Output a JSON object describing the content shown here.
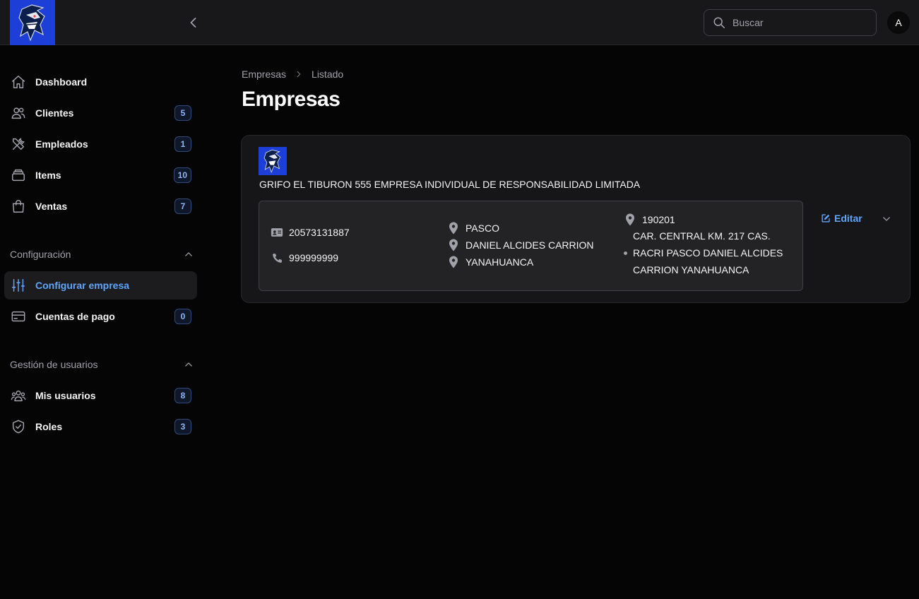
{
  "header": {
    "search": {
      "placeholder": "Buscar"
    },
    "user_initial": "A"
  },
  "sidebar": {
    "items": [
      {
        "label": "Dashboard",
        "icon": "home-icon"
      },
      {
        "label": "Clientes",
        "icon": "users-icon",
        "badge": "5"
      },
      {
        "label": "Empleados",
        "icon": "tools-icon",
        "badge": "1"
      },
      {
        "label": "Items",
        "icon": "stack-icon",
        "badge": "10"
      },
      {
        "label": "Ventas",
        "icon": "shopping-bag-icon",
        "badge": "7"
      }
    ],
    "groups": [
      {
        "title": "Configuración",
        "items": [
          {
            "label": "Configurar empresa",
            "icon": "sliders-icon",
            "active": true
          },
          {
            "label": "Cuentas de pago",
            "icon": "credit-card-icon",
            "badge": "0"
          }
        ]
      },
      {
        "title": "Gestión de usuarios",
        "items": [
          {
            "label": "Mis usuarios",
            "icon": "user-group-icon",
            "badge": "8"
          },
          {
            "label": "Roles",
            "icon": "shield-check-icon",
            "badge": "3"
          }
        ]
      }
    ]
  },
  "main": {
    "breadcrumbs": [
      "Empresas",
      "Listado"
    ],
    "title": "Empresas",
    "company": {
      "name": "GRIFO EL TIBURON 555 EMPRESA INDIVIDUAL DE RESPONSABILIDAD LIMITADA",
      "ruc": "20573131887",
      "phone": "999999999",
      "department": "PASCO",
      "province": "DANIEL ALCIDES CARRION",
      "district": "YANAHUANCA",
      "ubigeo": "190201",
      "address_line1": "CAR. CENTRAL KM. 217 CAS.",
      "address_line2": "RACRI PASCO DANIEL ALCIDES",
      "address_line3": "CARRION YANAHUANCA",
      "edit_label": "Editar"
    }
  },
  "colors": {
    "accent": "#60a5fa",
    "brand": "#1d3fd8",
    "background": "#050505",
    "panel": "#161618"
  }
}
